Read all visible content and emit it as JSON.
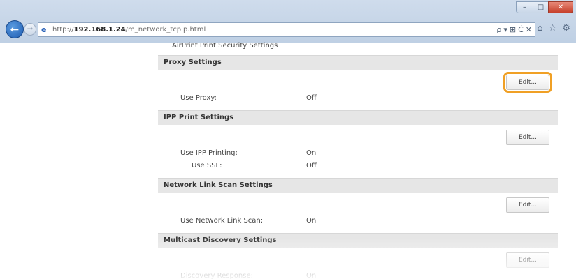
{
  "browser": {
    "url_prefix": "http://",
    "url_host": "192.168.1.24",
    "url_path": "/m_network_tcpip.html",
    "address_tools": [
      "ρ",
      "▾",
      "⊞",
      "Ċ",
      "✕"
    ],
    "toolbar_icons": [
      "home-icon",
      "star-icon",
      "gear-icon"
    ]
  },
  "page": {
    "top_truncated_text": "AirPrint Print Security Settings",
    "sections": [
      {
        "title": "Proxy Settings",
        "edit_label": "Edit...",
        "highlighted": true,
        "settings": [
          {
            "label": "Use Proxy:",
            "value": "Off"
          }
        ]
      },
      {
        "title": "IPP Print Settings",
        "edit_label": "Edit...",
        "settings": [
          {
            "label": "Use IPP Printing:",
            "value": "On"
          },
          {
            "label": "Use SSL:",
            "value": "Off"
          }
        ]
      },
      {
        "title": "Network Link Scan Settings",
        "edit_label": "Edit...",
        "settings": [
          {
            "label": "Use Network Link Scan:",
            "value": "On"
          }
        ]
      },
      {
        "title": "Multicast Discovery Settings",
        "edit_label": "Edit...",
        "settings": [
          {
            "label": "Discovery Response:",
            "value": "On"
          }
        ]
      }
    ]
  },
  "colors": {
    "highlight": "#f0a025",
    "header_bg": "#e6e6e6",
    "back_button": "#1d5bb0"
  }
}
